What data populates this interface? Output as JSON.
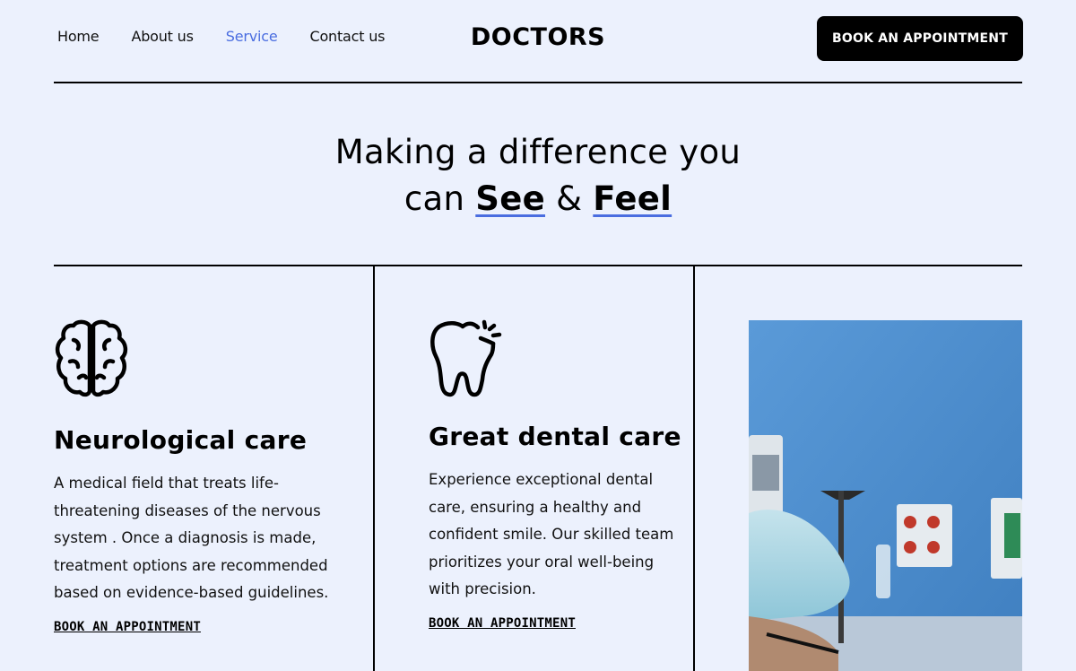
{
  "nav": {
    "items": [
      {
        "label": "Home"
      },
      {
        "label": "About us"
      },
      {
        "label": "Service"
      },
      {
        "label": "Contact us"
      }
    ],
    "active_index": 2
  },
  "logo": "DOCTORS",
  "header_cta": "BOOK AN APPOINTMENT",
  "hero": {
    "line1": "Making a difference you",
    "line2_prefix": "can",
    "word1": "See",
    "amp": "&",
    "word2": "Feel"
  },
  "cards": [
    {
      "icon": "brain-icon",
      "title": "Neurological care",
      "text": "A medical field that treats life-threatening diseases of the nervous system . Once a diagnosis is made, treatment options are recommended based on evidence-based guidelines.",
      "link": "BOOK AN  APPOINTMENT"
    },
    {
      "icon": "tooth-icon",
      "title": "Great dental care",
      "text": "Experience exceptional dental care, ensuring a healthy and confident smile. Our skilled team prioritizes your oral well-being with precision.",
      "link": "BOOK AN  APPOINTMENT"
    }
  ],
  "colors": {
    "background": "#ecf1fd",
    "accent": "#4a6de0",
    "button": "#000000"
  }
}
